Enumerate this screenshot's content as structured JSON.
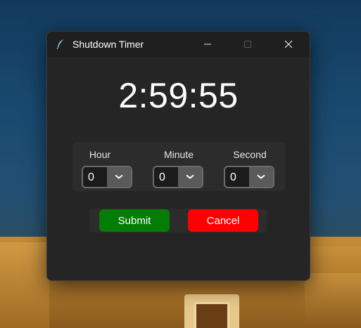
{
  "window": {
    "title": "Shutdown Timer",
    "icons": [
      "feather-icon",
      "minimize-icon",
      "maximize-icon",
      "close-icon"
    ]
  },
  "timer": {
    "remaining": "2:59:55"
  },
  "fields": [
    {
      "label": "Hour",
      "value": "0"
    },
    {
      "label": "Minute",
      "value": "0"
    },
    {
      "label": "Second",
      "value": "0"
    }
  ],
  "buttons": {
    "submit": "Submit",
    "cancel": "Cancel"
  },
  "colors": {
    "window_bg": "#252525",
    "submit": "#047d06",
    "cancel": "#ff0000"
  }
}
